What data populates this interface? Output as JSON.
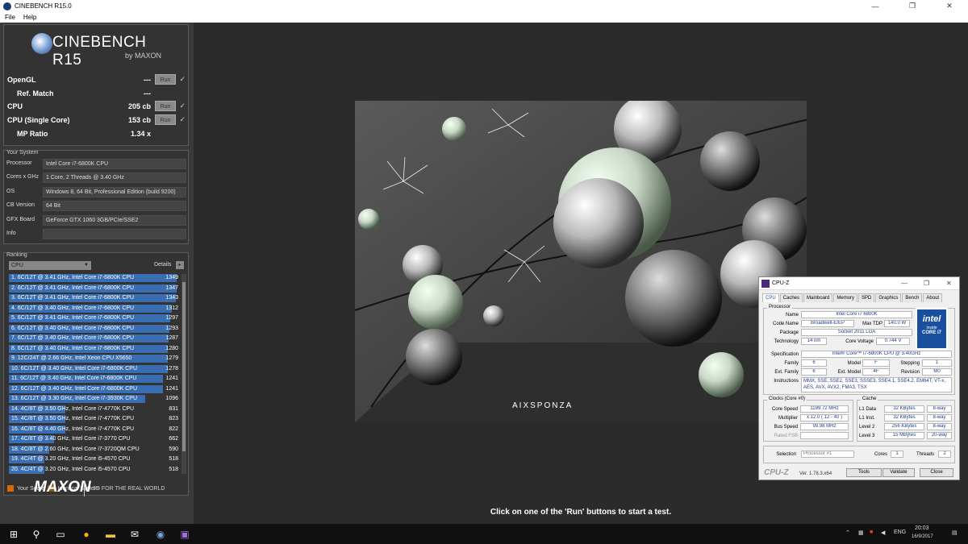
{
  "window": {
    "title": "CINEBENCH R15.0",
    "minimize": "—",
    "maximize": "❐",
    "close": "✕"
  },
  "menu": [
    "File",
    "Help"
  ],
  "logo": {
    "name": "CINEBENCH R15",
    "by": "by MAXON"
  },
  "tests": [
    {
      "label": "OpenGL",
      "value": "---",
      "run": "Run",
      "check": "✓"
    },
    {
      "label": "Ref. Match",
      "value": "---"
    },
    {
      "label": "CPU",
      "value": "205 cb",
      "run": "Run",
      "check": "✓"
    },
    {
      "label": "CPU (Single Core)",
      "value": "153 cb",
      "run": "Run",
      "check": "✓"
    },
    {
      "label": "MP Ratio",
      "value": "1.34 x"
    }
  ],
  "system": {
    "title": "Your System",
    "rows": [
      {
        "key": "Processor",
        "value": "Intel Core i7-6800K CPU"
      },
      {
        "key": "Cores x GHz",
        "value": "1 Core, 2 Threads @ 3.40 GHz"
      },
      {
        "key": "OS",
        "value": "Windows 8, 64 Bit, Professional Edition (build 9200)"
      },
      {
        "key": "CB Version",
        "value": "64 Bit"
      },
      {
        "key": "GFX Board",
        "value": "GeForce GTX 1060 3GB/PCIe/SSE2"
      },
      {
        "key": "Info",
        "value": ""
      }
    ]
  },
  "ranking": {
    "title": "Ranking",
    "dropdown": "CPU",
    "dropdown_arrow": "▼",
    "details": "Details",
    "details_btn": "▸",
    "max_score": 1349,
    "rows": [
      {
        "text": "1. 6C/12T @ 3.41 GHz, Intel Core i7-6800K CPU",
        "score": "1349",
        "v": 1349
      },
      {
        "text": "2. 6C/12T @ 3.41 GHz, Intel Core i7-6800K CPU",
        "score": "1347",
        "v": 1347
      },
      {
        "text": "3. 6C/12T @ 3.41 GHz, Intel Core i7-6800K CPU",
        "score": "1343",
        "v": 1343
      },
      {
        "text": "4. 6C/12T @ 3.40 GHz, Intel Core i7-6800K CPU",
        "score": "1312",
        "v": 1312
      },
      {
        "text": "5. 6C/12T @ 3.41 GHz, Intel Core i7-6800K CPU",
        "score": "1297",
        "v": 1297
      },
      {
        "text": "6. 6C/12T @ 3.40 GHz, Intel Core i7-6800K CPU",
        "score": "1293",
        "v": 1293
      },
      {
        "text": "7. 6C/12T @ 3.40 GHz, Intel Core i7-6800K CPU",
        "score": "1287",
        "v": 1287
      },
      {
        "text": "8. 6C/12T @ 3.40 GHz, Intel Core i7-6800K CPU",
        "score": "1280",
        "v": 1280
      },
      {
        "text": "9. 12C/24T @ 2.66 GHz, Intel Xeon CPU X5650",
        "score": "1279",
        "v": 1279
      },
      {
        "text": "10. 6C/12T @ 3.40 GHz, Intel Core i7-6800K CPU",
        "score": "1278",
        "v": 1278
      },
      {
        "text": "11. 6C/12T @ 3.40 GHz, Intel Core i7-6800K CPU",
        "score": "1241",
        "v": 1241
      },
      {
        "text": "12. 6C/12T @ 3.40 GHz, Intel Core i7-6800K CPU",
        "score": "1241",
        "v": 1241
      },
      {
        "text": "13. 6C/12T @ 3.30 GHz,  Intel Core i7-3930K CPU",
        "score": "1096",
        "v": 1096
      },
      {
        "text": "14. 4C/8T @ 3.50 GHz, Intel Core i7-4770K CPU",
        "score": "831",
        "v": 831
      },
      {
        "text": "15. 4C/8T @ 3.50 GHz, Intel Core i7-4770K CPU",
        "score": "823",
        "v": 823
      },
      {
        "text": "16. 4C/8T @ 4.40 GHz, Intel Core i7-4770K CPU",
        "score": "822",
        "v": 822
      },
      {
        "text": "17. 4C/8T @ 3.40 GHz,  Intel Core i7-3770 CPU",
        "score": "662",
        "v": 662
      },
      {
        "text": "18. 4C/8T @ 2.60 GHz, Intel Core i7-3720QM CPU",
        "score": "590",
        "v": 590
      },
      {
        "text": "19. 4C/4T @ 3.20 GHz, Intel Core i5-4570 CPU",
        "score": "518",
        "v": 518
      },
      {
        "text": "20. 4C/4T @ 3.20 GHz, Intel Core i5-4570 CPU",
        "score": "518",
        "v": 518
      }
    ],
    "legend": [
      {
        "label": "Your Score",
        "color": "#d66a00"
      },
      {
        "label": "Identical System",
        "color": "#8a5a1a"
      }
    ]
  },
  "maxon": {
    "logo": "MAXON",
    "tagline": "3D FOR THE REAL WORLD"
  },
  "render": {
    "watermark": "AIXSPONZA"
  },
  "status": "Click on one of the 'Run' buttons to start a test.",
  "cpuz": {
    "title": "CPU-Z",
    "tabs": [
      "CPU",
      "Caches",
      "Mainboard",
      "Memory",
      "SPD",
      "Graphics",
      "Bench",
      "About"
    ],
    "processor": {
      "group": "Processor",
      "name_l": "Name",
      "name": "Intel Core i7 6800K",
      "code_l": "Code Name",
      "code": "Broadwell-E/EP",
      "tdp_l": "Max TDP",
      "tdp": "140.0 W",
      "pkg_l": "Package",
      "pkg": "Socket 2011 LGA",
      "tech_l": "Technology",
      "tech": "14 nm",
      "volt_l": "Core Voltage",
      "volt": "0.744 V",
      "spec_l": "Specification",
      "spec": "Intel® Core™ i7-6800K CPU @ 3.40GHz",
      "fam_l": "Family",
      "fam": "6",
      "model_l": "Model",
      "model": "F",
      "step_l": "Stepping",
      "step": "1",
      "efam_l": "Ext. Family",
      "efam": "6",
      "emodel_l": "Ext. Model",
      "emodel": "4F",
      "rev_l": "Revision",
      "rev": "M0",
      "instr_l": "Instructions",
      "instr": "MMX, SSE, SSE2, SSE3, SSSE3, SSE4.1, SSE4.2, EM64T, VT-x, AES, AVX, AVX2, FMA3, TSX"
    },
    "intel": {
      "brand": "intel",
      "inside": "inside",
      "core": "CORE i7"
    },
    "clocks": {
      "group": "Clocks (Core #0)",
      "cs_l": "Core Speed",
      "cs": "1199.72 MHz",
      "mul_l": "Multiplier",
      "mul": "x 12.0 ( 12 - 40 )",
      "bus_l": "Bus Speed",
      "bus": "99.98 MHz",
      "fsb_l": "Rated FSB",
      "fsb": ""
    },
    "cache": {
      "group": "Cache",
      "rows": [
        {
          "l": "L1 Data",
          "s": "32 KBytes",
          "w": "8-way"
        },
        {
          "l": "L1 Inst.",
          "s": "32 KBytes",
          "w": "8-way"
        },
        {
          "l": "Level 2",
          "s": "256 KBytes",
          "w": "8-way"
        },
        {
          "l": "Level 3",
          "s": "15 MBytes",
          "w": "20-way"
        }
      ]
    },
    "selection_l": "Selection",
    "selection": "Processor #1",
    "cores_l": "Cores",
    "cores": "1",
    "threads_l": "Threads",
    "threads": "2",
    "brand": "CPU-Z",
    "version": "Ver. 1.78.3.x64",
    "tools": "Tools",
    "validate": "Validate",
    "close": "Close"
  },
  "taskbar": {
    "lang": "ENG",
    "time": "20:03",
    "date": "16/9/2017"
  }
}
